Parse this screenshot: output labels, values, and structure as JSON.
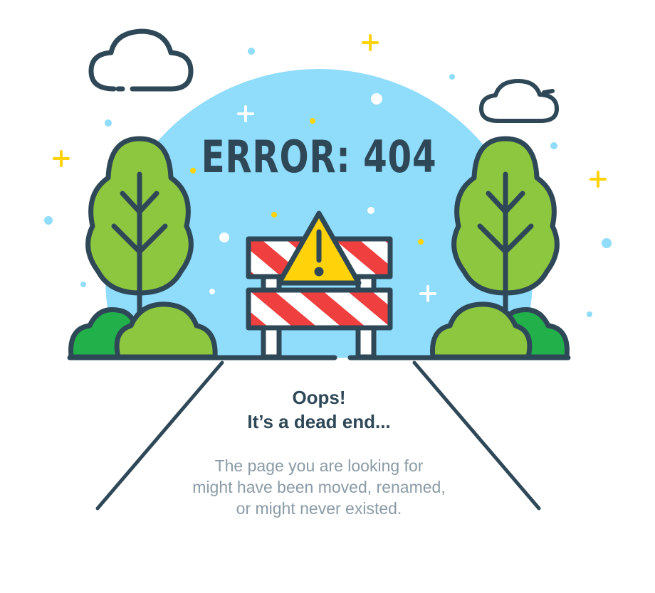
{
  "error": {
    "title": "ERROR: 404"
  },
  "heading": {
    "line1": "Oops!",
    "line2": "It’s a dead end..."
  },
  "message": {
    "line1": "The page you are looking for",
    "line2": "might have been moved, renamed,",
    "line3": "or might never existed."
  },
  "colors": {
    "ink": "#2f4858",
    "sky": "#8fdcfb",
    "tree": "#8dc63f",
    "bush_dark": "#22b04b",
    "stripe": "#ef3f3f",
    "warning": "#ffd20a",
    "sparkle": "#ffd20a",
    "muted_text": "#8a9ba6"
  },
  "icons": [
    "cloud-icon",
    "tree-icon",
    "bush-icon",
    "road-barrier-icon",
    "warning-icon",
    "sparkle-icon"
  ]
}
